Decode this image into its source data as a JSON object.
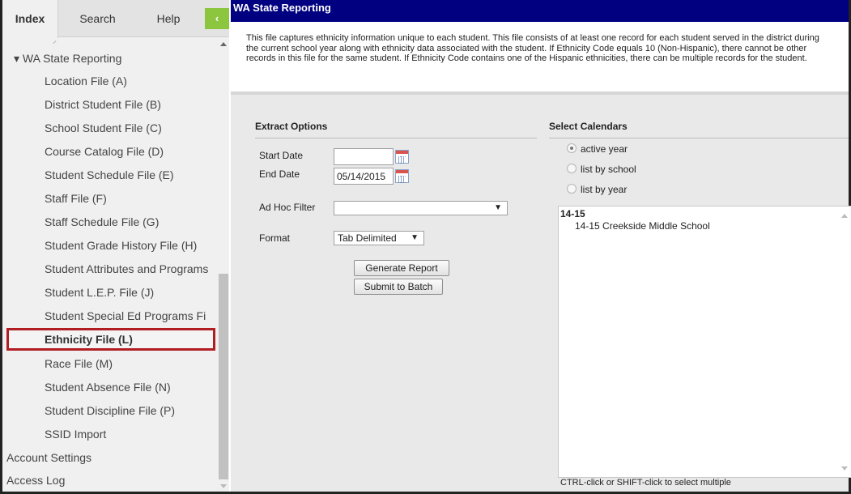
{
  "sidebar": {
    "tabs": [
      "Index",
      "Search",
      "Help"
    ],
    "collapse_icon": "‹",
    "tree": {
      "section": "▾ WA State Reporting",
      "items": [
        "Location File (A)",
        "District Student File (B)",
        "School Student File (C)",
        "Course Catalog File (D)",
        "Student Schedule File (E)",
        "Staff File (F)",
        "Staff Schedule File (G)",
        "Student Grade History File (H)",
        "Student Attributes and Programs",
        "Student L.E.P. File (J)",
        "Student Special Ed Programs Fi",
        "Ethnicity File (L)",
        "Race File (M)",
        "Student Absence File (N)",
        "Student Discipline File (P)",
        "SSID Import"
      ],
      "selected_index": 11,
      "bottom_items": [
        "Account Settings",
        "Access Log"
      ]
    },
    "selected_border_color": "#b01e23"
  },
  "main": {
    "title": "WA State Reporting",
    "title_bg": "#000080",
    "description": "This file captures ethnicity information unique to each student. This file consists of at least one record for each student served in the district during the current school year along with ethnicity data associated with the student. If Ethnicity Code equals 10 (Non-Hispanic), there cannot be other records in this file for the same student. If Ethnicity Code contains one of the Hispanic ethnicities, there can be multiple records for the student.",
    "extract": {
      "header": "Extract Options",
      "start_date_label": "Start Date",
      "start_date_value": "",
      "end_date_label": "End Date",
      "end_date_value": "05/14/2015",
      "adhoc_label": "Ad Hoc Filter",
      "adhoc_value": "",
      "format_label": "Format",
      "format_value": "Tab Delimited",
      "dropdown_arrow": "▼",
      "generate_label": "Generate Report",
      "batch_label": "Submit to Batch"
    },
    "calendars": {
      "header": "Select Calendars",
      "options": [
        "active year",
        "list by school",
        "list by year"
      ],
      "selected_option": "active year",
      "group": "14-15",
      "items": [
        "14-15 Creekside Middle School"
      ],
      "hint": "CTRL-click or SHIFT-click to select multiple"
    }
  }
}
